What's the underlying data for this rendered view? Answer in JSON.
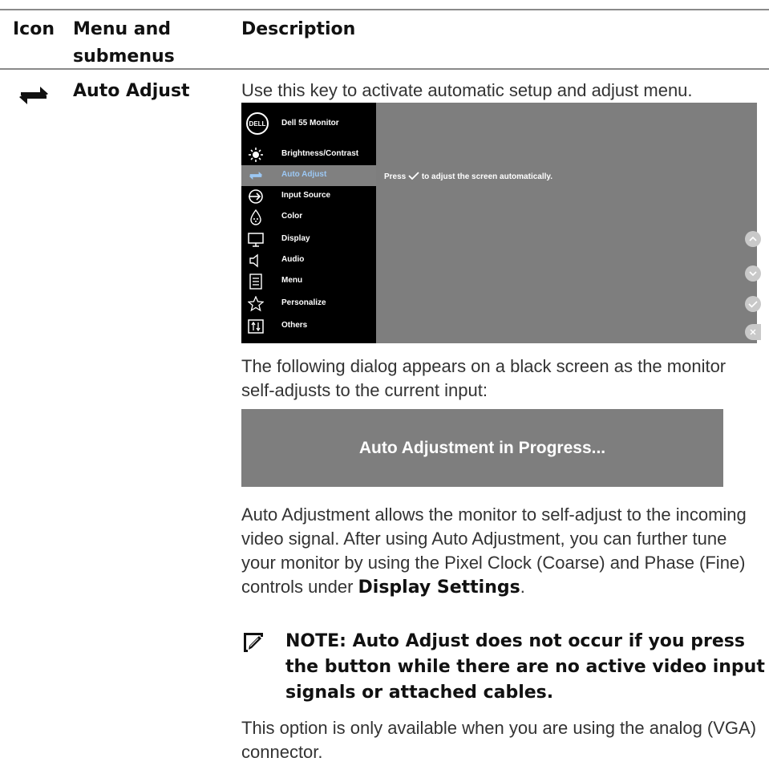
{
  "table": {
    "headers": {
      "icon": "Icon",
      "menu": "Menu and submenus",
      "description": "Description"
    },
    "row": {
      "icon": "auto-adjust-icon",
      "name": "Auto Adjust"
    }
  },
  "description": {
    "intro": "Use this key to activate automatic setup and adjust menu.",
    "dialog_intro": "The following dialog appears on a black screen as the monitor self-adjusts to the current input:",
    "auto_adjust_para": "Auto Adjustment allows the monitor to self-adjust to the incoming video signal. After using Auto Adjustment, you can further tune your monitor by using the Pixel Clock (Coarse) and Phase (Fine) controls under ",
    "auto_adjust_bold": "Display Settings",
    "auto_adjust_end": ".",
    "note": "NOTE: Auto Adjust does not occur if you press the button while there are no active video input signals or attached cables.",
    "vga_para": "This option is only available when you are using the analog (VGA) connector."
  },
  "osd": {
    "logo": "DELL",
    "title": "Dell 55 Monitor",
    "menu": [
      {
        "label": "Brightness/Contrast",
        "icon": "brightness-icon"
      },
      {
        "label": "Auto Adjust",
        "icon": "auto-adjust-icon",
        "active": true
      },
      {
        "label": "Input Source",
        "icon": "input-source-icon"
      },
      {
        "label": "Color",
        "icon": "color-icon"
      },
      {
        "label": "Display",
        "icon": "display-icon"
      },
      {
        "label": "Audio",
        "icon": "speaker-icon"
      },
      {
        "label": "Menu",
        "icon": "menu-icon"
      },
      {
        "label": "Personalize",
        "icon": "star-icon"
      },
      {
        "label": "Others",
        "icon": "others-icon"
      }
    ],
    "message_prefix": "Press",
    "message_suffix": "to adjust the screen automatically.",
    "buttons": [
      "up-icon",
      "down-icon",
      "check-icon",
      "close-icon"
    ],
    "accent_color": "#9cc8f4"
  },
  "dialog": {
    "text": "Auto Adjustment in Progress..."
  }
}
